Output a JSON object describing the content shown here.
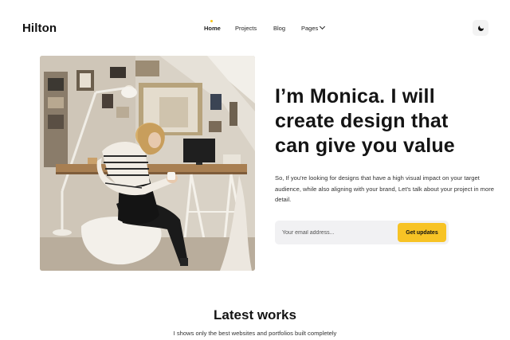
{
  "header": {
    "logo": "Hilton",
    "nav": [
      {
        "label": "Home"
      },
      {
        "label": "Projects"
      },
      {
        "label": "Blog"
      },
      {
        "label": "Pages"
      }
    ],
    "theme_icon": "moon-icon"
  },
  "hero": {
    "title": "I’m Monica. I will create design that can give you value",
    "description": "So, If you're looking for designs that have a high visual impact on your target audience, while also aligning with your brand, Let's talk about your project in more detail.",
    "email_placeholder": "Your email address...",
    "button_label": "Get updates",
    "accent_color": "#f7c325"
  },
  "works": {
    "title": "Latest works",
    "subtitle": "I shows only the best websites and portfolios built completely"
  }
}
